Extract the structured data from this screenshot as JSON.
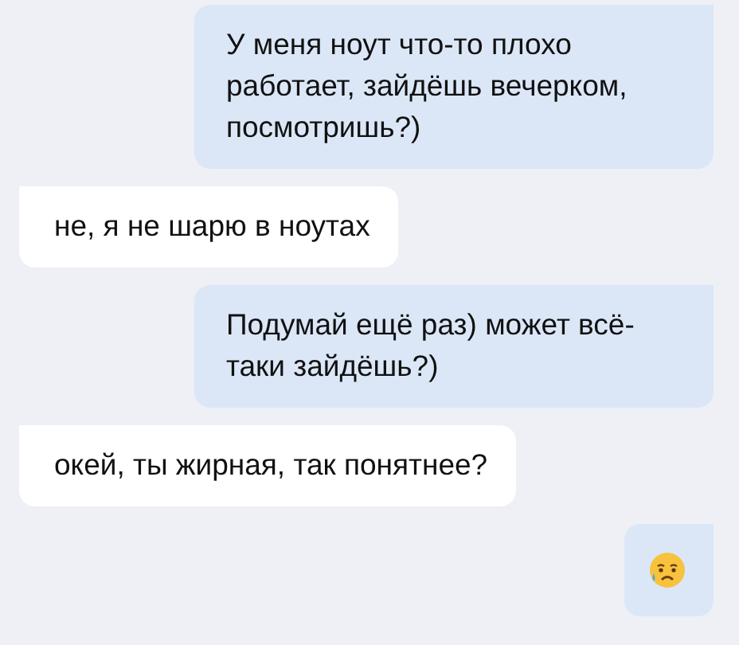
{
  "messages": [
    {
      "outgoing": true,
      "kind": "text",
      "text": "У меня ноут что-то плохо работает, зайдёшь вечерком, посмотришь?)"
    },
    {
      "outgoing": false,
      "kind": "text",
      "text": "не, я не шарю в ноутах"
    },
    {
      "outgoing": true,
      "kind": "text",
      "text": "Подумай ещё раз) может всё-таки зайдёшь?)"
    },
    {
      "outgoing": false,
      "kind": "text",
      "text": "окей, ты жирная, так понятнее?"
    },
    {
      "outgoing": true,
      "kind": "emoji"
    }
  ]
}
